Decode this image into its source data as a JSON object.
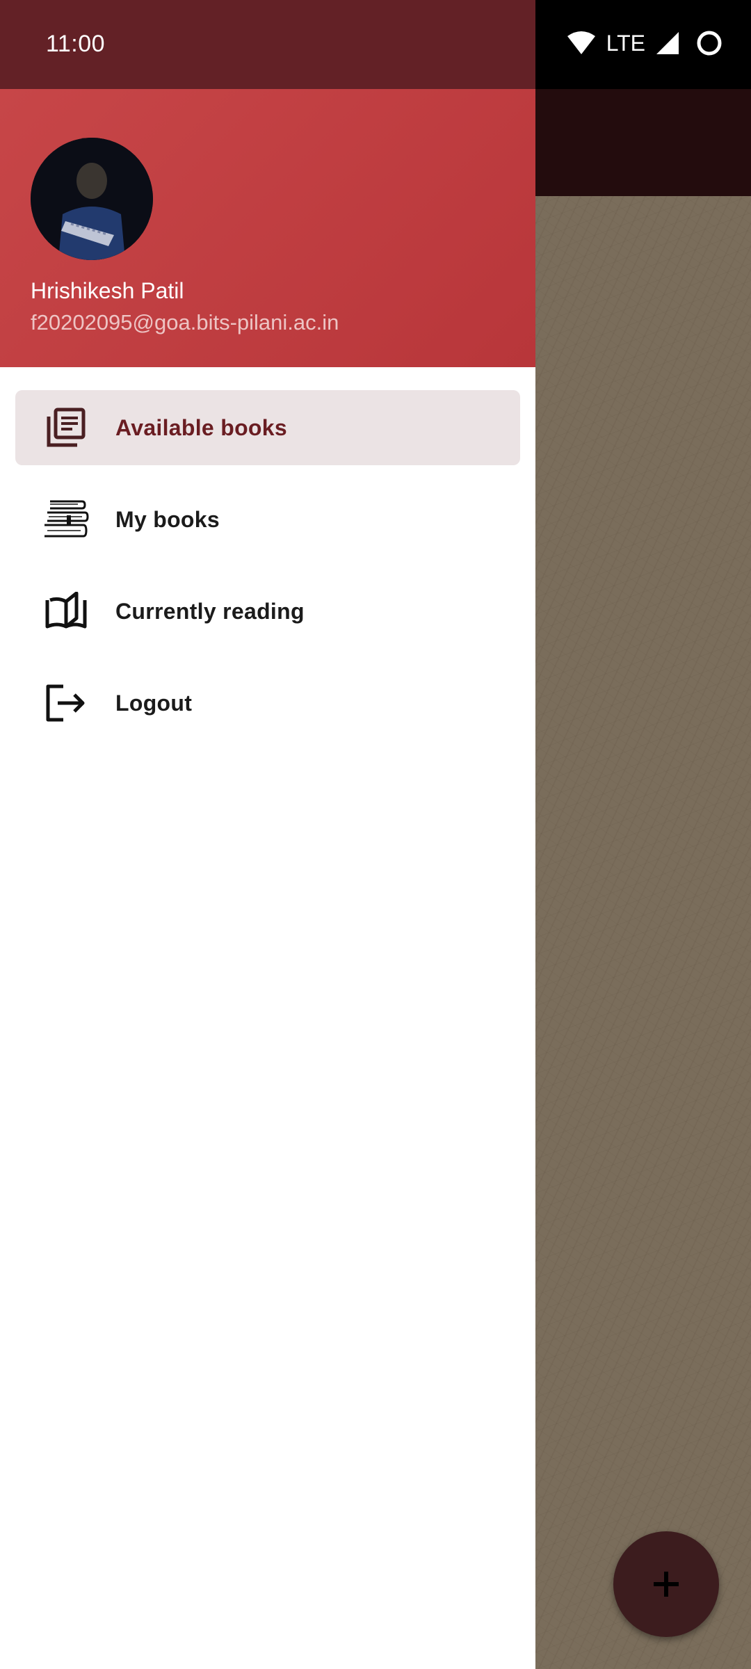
{
  "status_bar": {
    "time": "11:00",
    "network": "LTE"
  },
  "drawer": {
    "user": {
      "name": "Hrishikesh Patil",
      "email": "f20202095@goa.bits-pilani.ac.in"
    },
    "items": [
      {
        "label": "Available books",
        "icon": "library-books-icon",
        "selected": true
      },
      {
        "label": "My books",
        "icon": "book-stack-icon",
        "selected": false
      },
      {
        "label": "Currently reading",
        "icon": "open-book-icon",
        "selected": false
      },
      {
        "label": "Logout",
        "icon": "logout-icon",
        "selected": false
      }
    ]
  },
  "fab": {
    "icon": "plus-icon"
  },
  "colors": {
    "header": "#c03f42",
    "status_bar_drawer": "#632126",
    "selected_item_bg": "#ebe3e4",
    "selected_item_text": "#6a1d22",
    "fab": "#3c1c1e"
  }
}
